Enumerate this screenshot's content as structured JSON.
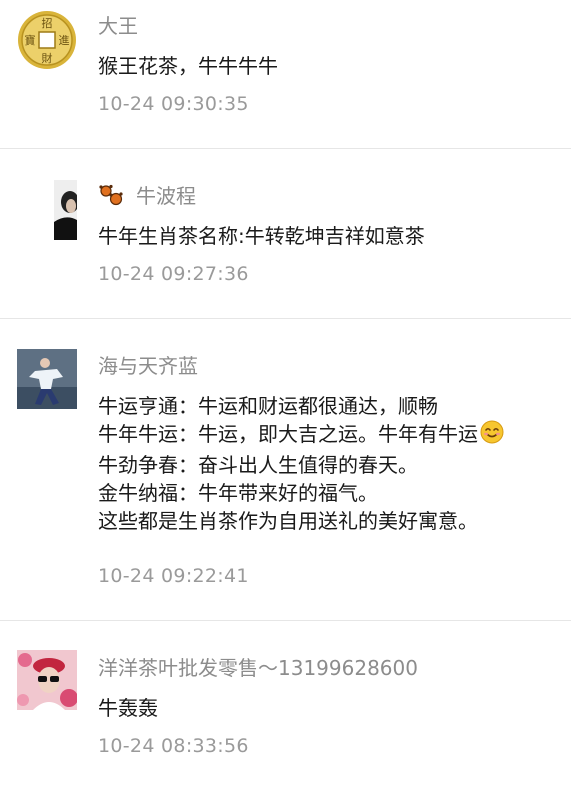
{
  "comments": [
    {
      "author": "大王",
      "lines": [
        "猴王花茶，牛牛牛牛"
      ],
      "time": "10-24 09:30:35"
    },
    {
      "author": "牛波程",
      "lines": [
        "牛年生肖茶名称:牛转乾坤吉祥如意茶"
      ],
      "time": "10-24 09:27:36"
    },
    {
      "author": "海与天齐蓝",
      "lines": [
        "牛运亨通：牛运和财运都很通达，顺畅",
        "牛年牛运：牛运，即大吉之运。牛年有牛运",
        "牛劲争春：奋斗出人生值得的春天。",
        "金牛纳福：牛年带来好的福气。",
        "这些都是生肖茶作为自用送礼的美好寓意。"
      ],
      "time": "10-24 09:22:41"
    },
    {
      "author": "洋洋茶叶批发零售～13199628600",
      "lines": [
        "牛轰轰"
      ],
      "time": "10-24 08:33:56"
    }
  ],
  "coin_text": [
    "招",
    "進",
    "財",
    "寶"
  ]
}
